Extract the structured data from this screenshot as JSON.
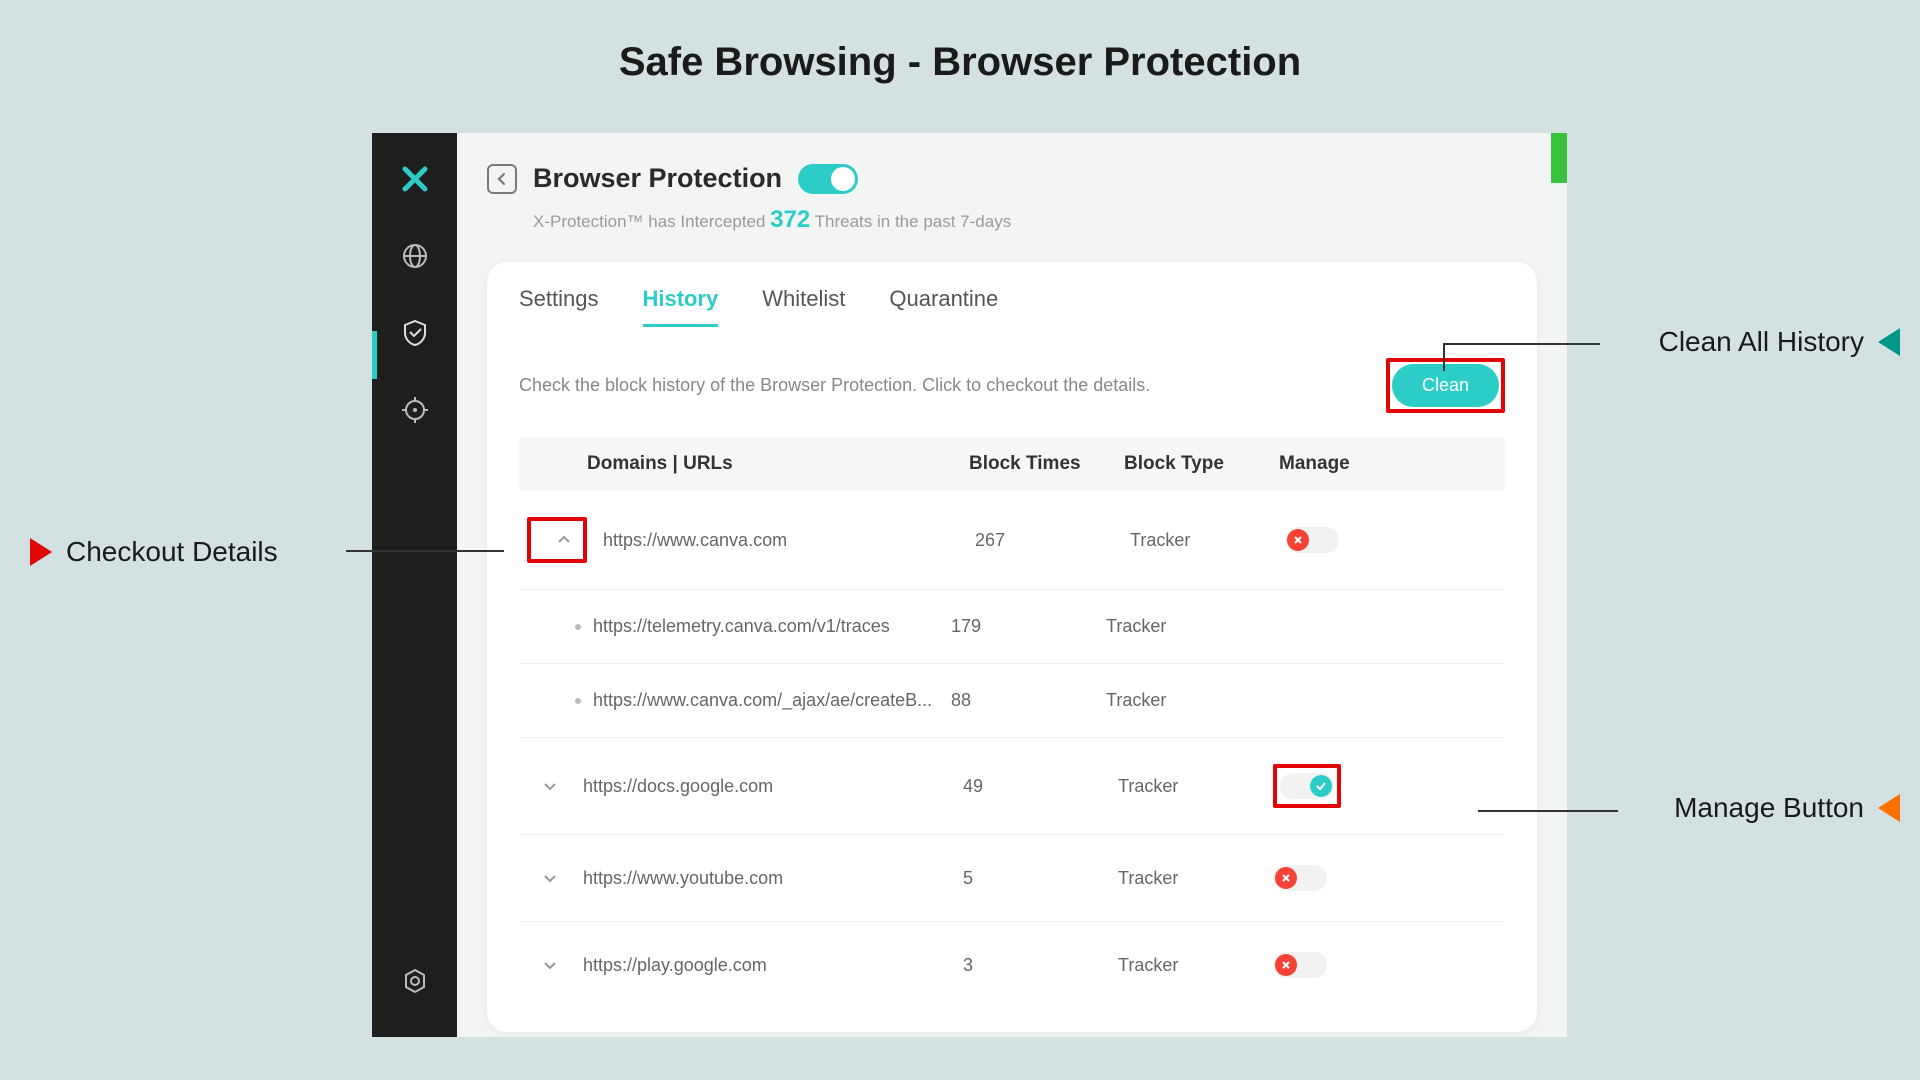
{
  "page_title": "Safe Browsing - Browser Protection",
  "header": {
    "title": "Browser Protection",
    "toggle_on": true,
    "subtitle_prefix": "X-Protection™ ",
    "subtitle_mid": "has Intercepted ",
    "threat_count": "372",
    "subtitle_suffix": " Threats in the past 7-days"
  },
  "tabs": {
    "settings": "Settings",
    "history": "History",
    "whitelist": "Whitelist",
    "quarantine": "Quarantine"
  },
  "instruction": "Check the block history of the Browser Protection. Click to checkout the details.",
  "clean_label": "Clean",
  "columns": {
    "domain": "Domains | URLs",
    "times": "Block Times",
    "type": "Block Type",
    "manage": "Manage"
  },
  "rows": [
    {
      "expanded": true,
      "url": "https://www.canva.com",
      "times": "267",
      "type": "Tracker",
      "switch": "off"
    },
    {
      "sub": true,
      "url": "https://telemetry.canva.com/v1/traces",
      "times": "179",
      "type": "Tracker"
    },
    {
      "sub": true,
      "url": "https://www.canva.com/_ajax/ae/createB...",
      "times": "88",
      "type": "Tracker"
    },
    {
      "expanded": false,
      "url": "https://docs.google.com",
      "times": "49",
      "type": "Tracker",
      "switch": "on"
    },
    {
      "expanded": false,
      "url": "https://www.youtube.com",
      "times": "5",
      "type": "Tracker",
      "switch": "off"
    },
    {
      "expanded": false,
      "url": "https://play.google.com",
      "times": "3",
      "type": "Tracker",
      "switch": "off"
    }
  ],
  "callouts": {
    "checkout": "Checkout Details",
    "clean_all": "Clean All History",
    "manage": "Manage Button"
  }
}
